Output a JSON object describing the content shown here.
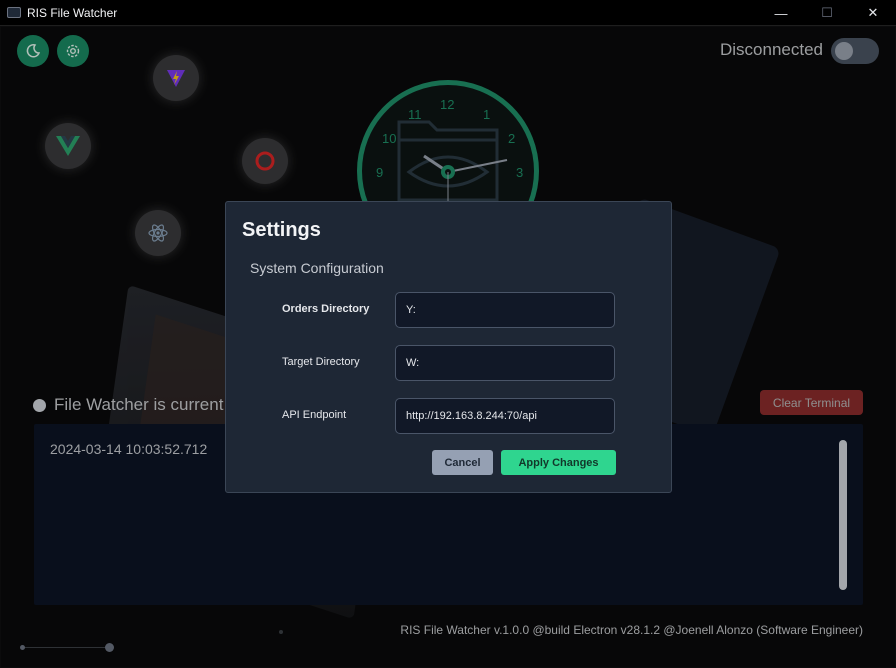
{
  "window": {
    "title": "RIS File Watcher",
    "minimize_glyph": "—",
    "maximize_glyph": "☐",
    "close_glyph": "✕"
  },
  "header": {
    "connection_status": "Disconnected",
    "theme_icon": "moon-icon",
    "settings_icon": "gear-icon"
  },
  "clock": {
    "numbers": [
      "12",
      "1",
      "2",
      "3",
      "9",
      "10",
      "11"
    ]
  },
  "watcher": {
    "status_text": "File Watcher is current"
  },
  "terminal": {
    "clear_label": "Clear Terminal",
    "lines": [
      "2024-03-14 10:03:52.712"
    ]
  },
  "footer": {
    "text": "RIS File Watcher v.1.0.0 @build Electron v28.1.2 @Joenell Alonzo (Software Engineer)"
  },
  "settings_modal": {
    "title": "Settings",
    "subtitle": "System Configuration",
    "fields": [
      {
        "label": "Orders Directory",
        "value": "Y:"
      },
      {
        "label": "Target Directory",
        "value": "W:"
      },
      {
        "label": "API Endpoint",
        "value": "http://192.163.8.244:70/api"
      }
    ],
    "cancel_label": "Cancel",
    "apply_label": "Apply Changes"
  },
  "colors": {
    "accent_green": "#1a8a63",
    "apply_green": "#2fd58f",
    "danger_red": "#c23b3b",
    "modal_bg": "#1e2735"
  }
}
